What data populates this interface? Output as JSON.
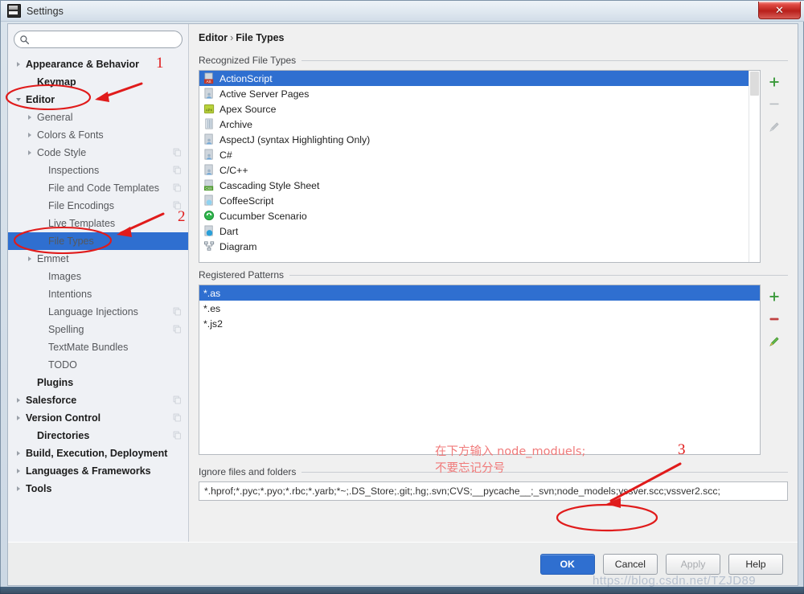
{
  "window": {
    "title": "Settings",
    "icon": "settings-app-icon",
    "close_label": "✕"
  },
  "search": {
    "value": "",
    "placeholder": "",
    "icon": "search-icon"
  },
  "sidebar": {
    "items": [
      {
        "label": "Appearance & Behavior",
        "indent": 0,
        "twisty": "collapsed",
        "bold": true,
        "badge": false
      },
      {
        "label": "Keymap",
        "indent": 1,
        "twisty": "none",
        "bold": true,
        "badge": false
      },
      {
        "label": "Editor",
        "indent": 0,
        "twisty": "expanded",
        "bold": true,
        "badge": false
      },
      {
        "label": "General",
        "indent": 1,
        "twisty": "collapsed",
        "bold": false,
        "badge": false
      },
      {
        "label": "Colors & Fonts",
        "indent": 1,
        "twisty": "collapsed",
        "bold": false,
        "badge": false
      },
      {
        "label": "Code Style",
        "indent": 1,
        "twisty": "collapsed",
        "bold": false,
        "badge": true
      },
      {
        "label": "Inspections",
        "indent": 2,
        "twisty": "none",
        "bold": false,
        "badge": true
      },
      {
        "label": "File and Code Templates",
        "indent": 2,
        "twisty": "none",
        "bold": false,
        "badge": true
      },
      {
        "label": "File Encodings",
        "indent": 2,
        "twisty": "none",
        "bold": false,
        "badge": true
      },
      {
        "label": "Live Templates",
        "indent": 2,
        "twisty": "none",
        "bold": false,
        "badge": false
      },
      {
        "label": "File Types",
        "indent": 2,
        "twisty": "none",
        "bold": false,
        "badge": false,
        "selected": true
      },
      {
        "label": "Emmet",
        "indent": 1,
        "twisty": "collapsed",
        "bold": false,
        "badge": false
      },
      {
        "label": "Images",
        "indent": 2,
        "twisty": "none",
        "bold": false,
        "badge": false
      },
      {
        "label": "Intentions",
        "indent": 2,
        "twisty": "none",
        "bold": false,
        "badge": false
      },
      {
        "label": "Language Injections",
        "indent": 2,
        "twisty": "none",
        "bold": false,
        "badge": true
      },
      {
        "label": "Spelling",
        "indent": 2,
        "twisty": "none",
        "bold": false,
        "badge": true
      },
      {
        "label": "TextMate Bundles",
        "indent": 2,
        "twisty": "none",
        "bold": false,
        "badge": false
      },
      {
        "label": "TODO",
        "indent": 2,
        "twisty": "none",
        "bold": false,
        "badge": false
      },
      {
        "label": "Plugins",
        "indent": 1,
        "twisty": "none",
        "bold": true,
        "badge": false
      },
      {
        "label": "Salesforce",
        "indent": 0,
        "twisty": "collapsed",
        "bold": true,
        "badge": true
      },
      {
        "label": "Version Control",
        "indent": 0,
        "twisty": "collapsed",
        "bold": true,
        "badge": true
      },
      {
        "label": "Directories",
        "indent": 1,
        "twisty": "none",
        "bold": true,
        "badge": true
      },
      {
        "label": "Build, Execution, Deployment",
        "indent": 0,
        "twisty": "collapsed",
        "bold": true,
        "badge": false
      },
      {
        "label": "Languages & Frameworks",
        "indent": 0,
        "twisty": "collapsed",
        "bold": true,
        "badge": false
      },
      {
        "label": "Tools",
        "indent": 0,
        "twisty": "collapsed",
        "bold": true,
        "badge": false
      }
    ]
  },
  "breadcrumb": {
    "parent": "Editor",
    "separator": "›",
    "current": "File Types"
  },
  "recognized": {
    "title": "Recognized File Types",
    "items": [
      {
        "label": "ActionScript",
        "icon": "actionscript-file-icon",
        "selected": true
      },
      {
        "label": "Active Server Pages",
        "icon": "asp-file-icon"
      },
      {
        "label": "Apex Source",
        "icon": "apex-file-icon"
      },
      {
        "label": "Archive",
        "icon": "archive-file-icon"
      },
      {
        "label": "AspectJ (syntax Highlighting Only)",
        "icon": "aspectj-file-icon"
      },
      {
        "label": "C#",
        "icon": "csharp-file-icon"
      },
      {
        "label": "C/C++",
        "icon": "cpp-file-icon"
      },
      {
        "label": "Cascading Style Sheet",
        "icon": "css-file-icon"
      },
      {
        "label": "CoffeeScript",
        "icon": "coffeescript-file-icon"
      },
      {
        "label": "Cucumber Scenario",
        "icon": "cucumber-file-icon"
      },
      {
        "label": "Dart",
        "icon": "dart-file-icon"
      },
      {
        "label": "Diagram",
        "icon": "diagram-file-icon"
      }
    ],
    "buttons": [
      {
        "name": "add-file-type-button",
        "icon": "plus-icon",
        "enabled": true
      },
      {
        "name": "remove-file-type-button",
        "icon": "minus-icon",
        "enabled": false
      },
      {
        "name": "edit-file-type-button",
        "icon": "pencil-icon",
        "enabled": false
      }
    ]
  },
  "patterns": {
    "title": "Registered Patterns",
    "items": [
      {
        "label": "*.as",
        "selected": true
      },
      {
        "label": "*.es"
      },
      {
        "label": "*.js2"
      }
    ],
    "buttons": [
      {
        "name": "add-pattern-button",
        "icon": "plus-icon",
        "enabled": true
      },
      {
        "name": "remove-pattern-button",
        "icon": "minus-icon",
        "enabled": true
      },
      {
        "name": "edit-pattern-button",
        "icon": "pencil-icon",
        "enabled": true
      }
    ]
  },
  "ignore": {
    "title": "Ignore files and folders",
    "value": "*.hprof;*.pyc;*.pyo;*.rbc;*.yarb;*~;.DS_Store;.git;.hg;.svn;CVS;__pycache__;_svn;node_models;vssver.scc;vssver2.scc;",
    "placeholder": ""
  },
  "footer": {
    "ok": "OK",
    "cancel": "Cancel",
    "apply": "Apply",
    "help": "Help"
  },
  "annotations": {
    "marker_1": "1",
    "marker_2": "2",
    "marker_3": "3",
    "note_line_1": "在下方输入 node_moduels;",
    "note_line_2": "不要忘记分号",
    "watermark": "https://blog.csdn.net/TZJD89"
  },
  "colors": {
    "selection": "#2f6fd0",
    "annotation_red": "#e01b1b",
    "note_pink": "#f07a7a",
    "add_green": "#3a9a3a",
    "remove_red": "#c04040"
  }
}
